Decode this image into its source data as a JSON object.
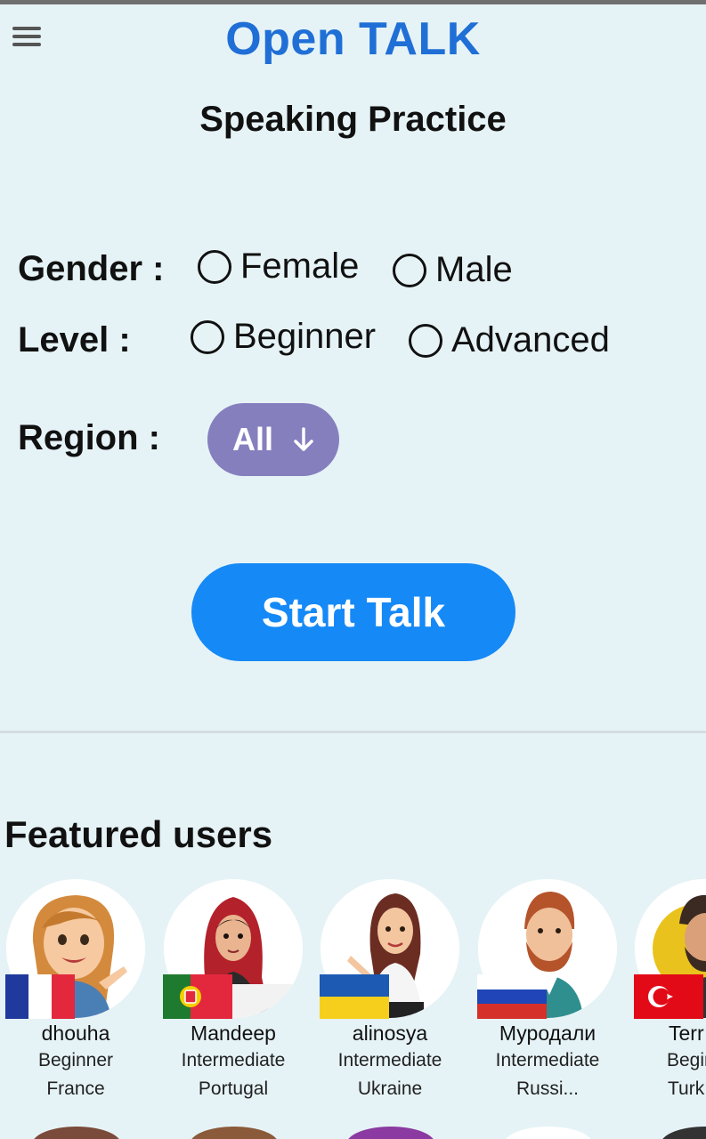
{
  "header": {
    "app_title": "Open TALK",
    "menu_icon": "hamburger-menu-icon"
  },
  "page": {
    "title": "Speaking Practice"
  },
  "form": {
    "gender_label": "Gender :",
    "gender_options": [
      "Female",
      "Male"
    ],
    "level_label": "Level :",
    "level_options": [
      "Beginner",
      "Advanced"
    ],
    "region_label": "Region :",
    "region_value": "All",
    "region_icon": "arrow-down-icon",
    "start_button": "Start Talk"
  },
  "featured": {
    "title": "Featured users",
    "users": [
      {
        "name": "dhouha",
        "level": "Beginner",
        "country": "France",
        "flag": "france-flag-icon"
      },
      {
        "name": "Mandeep",
        "level": "Intermediate",
        "country": "Portugal",
        "flag": "portugal-flag-icon"
      },
      {
        "name": "alinosya",
        "level": "Intermediate",
        "country": "Ukraine",
        "flag": "ukraine-flag-icon"
      },
      {
        "name": "Муродали",
        "level": "Intermediate",
        "country": "Russi...",
        "flag": "russia-flag-icon"
      },
      {
        "name": "Terr",
        "level": "Begin",
        "country": "Turk",
        "flag": "turkey-flag-icon"
      }
    ]
  },
  "colors": {
    "background": "#e6f3f6",
    "title_blue": "#1f6fd6",
    "region_button": "#857fbe",
    "start_button": "#1589f6"
  }
}
